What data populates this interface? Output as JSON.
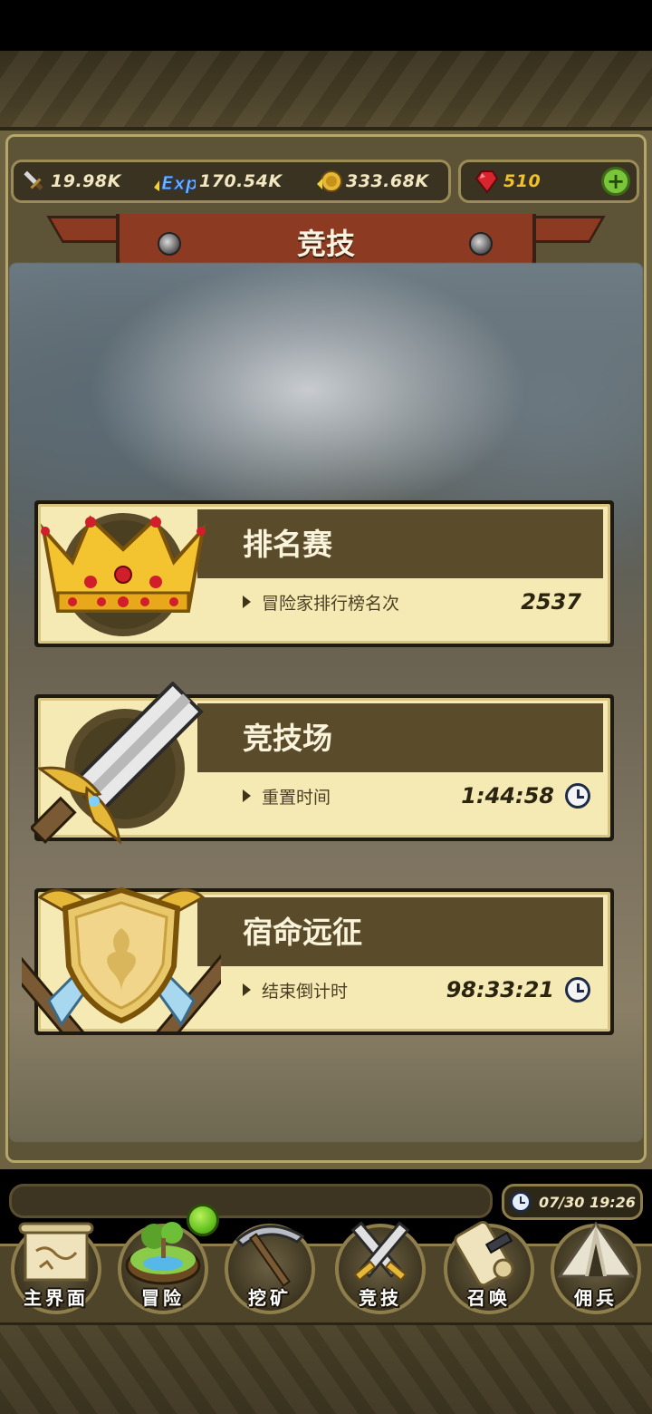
{
  "resources": {
    "attack": {
      "icon": "sword-icon",
      "value": "19.98K"
    },
    "exp": {
      "icon": "exp-icon",
      "label": "Exp",
      "value": "170.54K"
    },
    "coins": {
      "icon": "coin-icon",
      "value": "333.68K"
    },
    "gems": {
      "icon": "ruby-icon",
      "value": "510"
    }
  },
  "header": {
    "title": "竞技"
  },
  "modes": [
    {
      "title": "排名赛",
      "subtitle": "冒险家排行榜名次",
      "value": "2537",
      "icon": "crown-icon"
    },
    {
      "title": "竞技场",
      "subtitle": "重置时间",
      "value": "1:44:58",
      "icon": "sword-emblem-icon"
    },
    {
      "title": "宿命远征",
      "subtitle": "结束倒计时",
      "value": "98:33:21",
      "icon": "shield-emblem-icon"
    }
  ],
  "clock": {
    "datetime": "07/30 19:26"
  },
  "nav": [
    {
      "label": "主界面",
      "icon": "map-scroll-icon"
    },
    {
      "label": "冒险",
      "icon": "island-icon"
    },
    {
      "label": "挖矿",
      "icon": "pickaxe-icon"
    },
    {
      "label": "竞技",
      "icon": "crossed-swords-icon"
    },
    {
      "label": "召唤",
      "icon": "summon-scroll-icon"
    },
    {
      "label": "佣兵",
      "icon": "tent-icon"
    }
  ],
  "colors": {
    "banner": "#8c3b22",
    "card_bg": "#f6eab4",
    "card_band": "#5a4c2a",
    "gem_value": "#f0c22a",
    "notify_dot": "#5fbf1c"
  }
}
